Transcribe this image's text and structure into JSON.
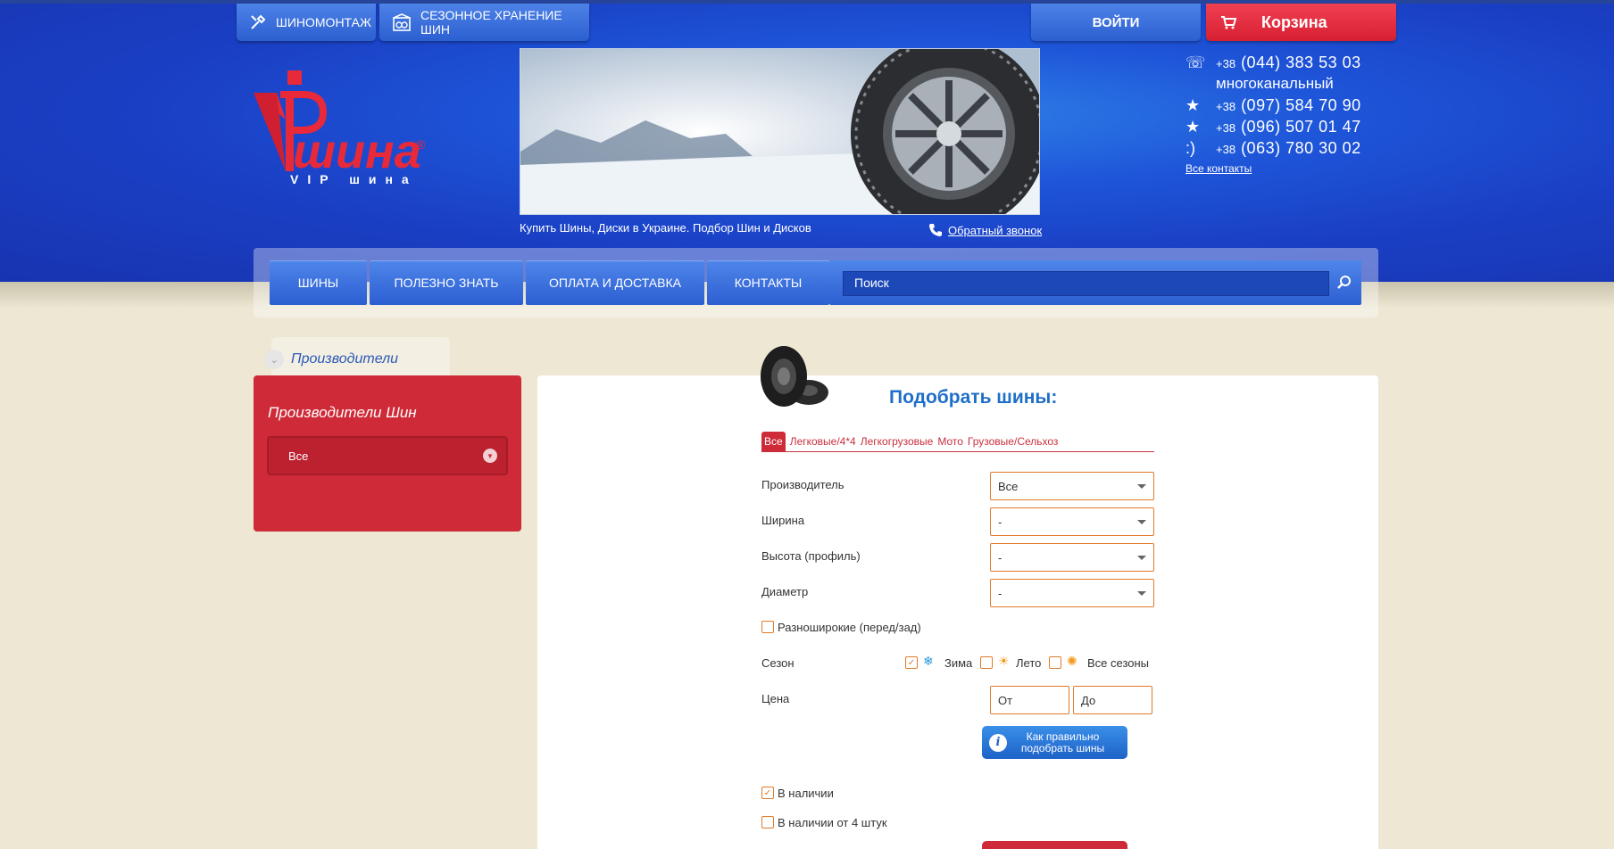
{
  "topbar": {
    "tire_fitting": "ШИНОМОНТАЖ",
    "storage": "СЕЗОННОЕ ХРАНЕНИЕ ШИН",
    "login": "ВОЙТИ",
    "cart": "Корзина"
  },
  "logo": {
    "main": "шина",
    "sub": "VIP шина"
  },
  "banner": {
    "caption": "Купить Шины, Диски в Украине. Подбор Шин и Дисков",
    "callback": "Обратный звонок"
  },
  "contacts": {
    "phones": [
      {
        "icon": "kyivstar-phone-icon",
        "code": "+38",
        "number": "(044) 383 53 03"
      },
      {
        "icon": "star-icon",
        "code": "+38",
        "number": "(097) 584 70 90"
      },
      {
        "icon": "star-icon",
        "code": "+38",
        "number": "(096) 507 01 47"
      },
      {
        "icon": "smile-icon",
        "code": "+38",
        "number": "(063) 780 30 02"
      }
    ],
    "multichannel": "многоканальный",
    "all": "Все контакты"
  },
  "nav": {
    "items": [
      "ШИНЫ",
      "ПОЛЕЗНО ЗНАТЬ",
      "ОПЛАТА И ДОСТАВКА",
      "КОНТАКТЫ"
    ],
    "search_placeholder": "Поиск"
  },
  "sidebar": {
    "tab": "Производители",
    "title": "Производители Шин",
    "select_value": "Все"
  },
  "main": {
    "title": "Подобрать шины:",
    "tabs": [
      "Все",
      "Легковые/4*4",
      "Легкогрузовые",
      "Мото",
      "Грузовые/Сельхоз"
    ],
    "fields": {
      "manufacturer": {
        "label": "Производитель",
        "value": "Все"
      },
      "width": {
        "label": "Ширина",
        "value": "-"
      },
      "height": {
        "label": "Высота (профиль)",
        "value": "-"
      },
      "diameter": {
        "label": "Диаметр",
        "value": "-"
      }
    },
    "wide": "Разноширокие (перед/зад)",
    "season": {
      "label": "Сезон",
      "winter": "Зима",
      "summer": "Лето",
      "all": "Все сезоны"
    },
    "price": {
      "label": "Цена",
      "from": "От",
      "to": "До"
    },
    "help": "Как правильно подобрать шины",
    "in_stock": "В наличии",
    "in_stock_4": "В наличии от 4 штук"
  },
  "colors": {
    "header_blue": "#1e55d9",
    "accent_red": "#cf2a38",
    "title_blue": "#1f6fc9",
    "input_border": "#e07a2b"
  }
}
